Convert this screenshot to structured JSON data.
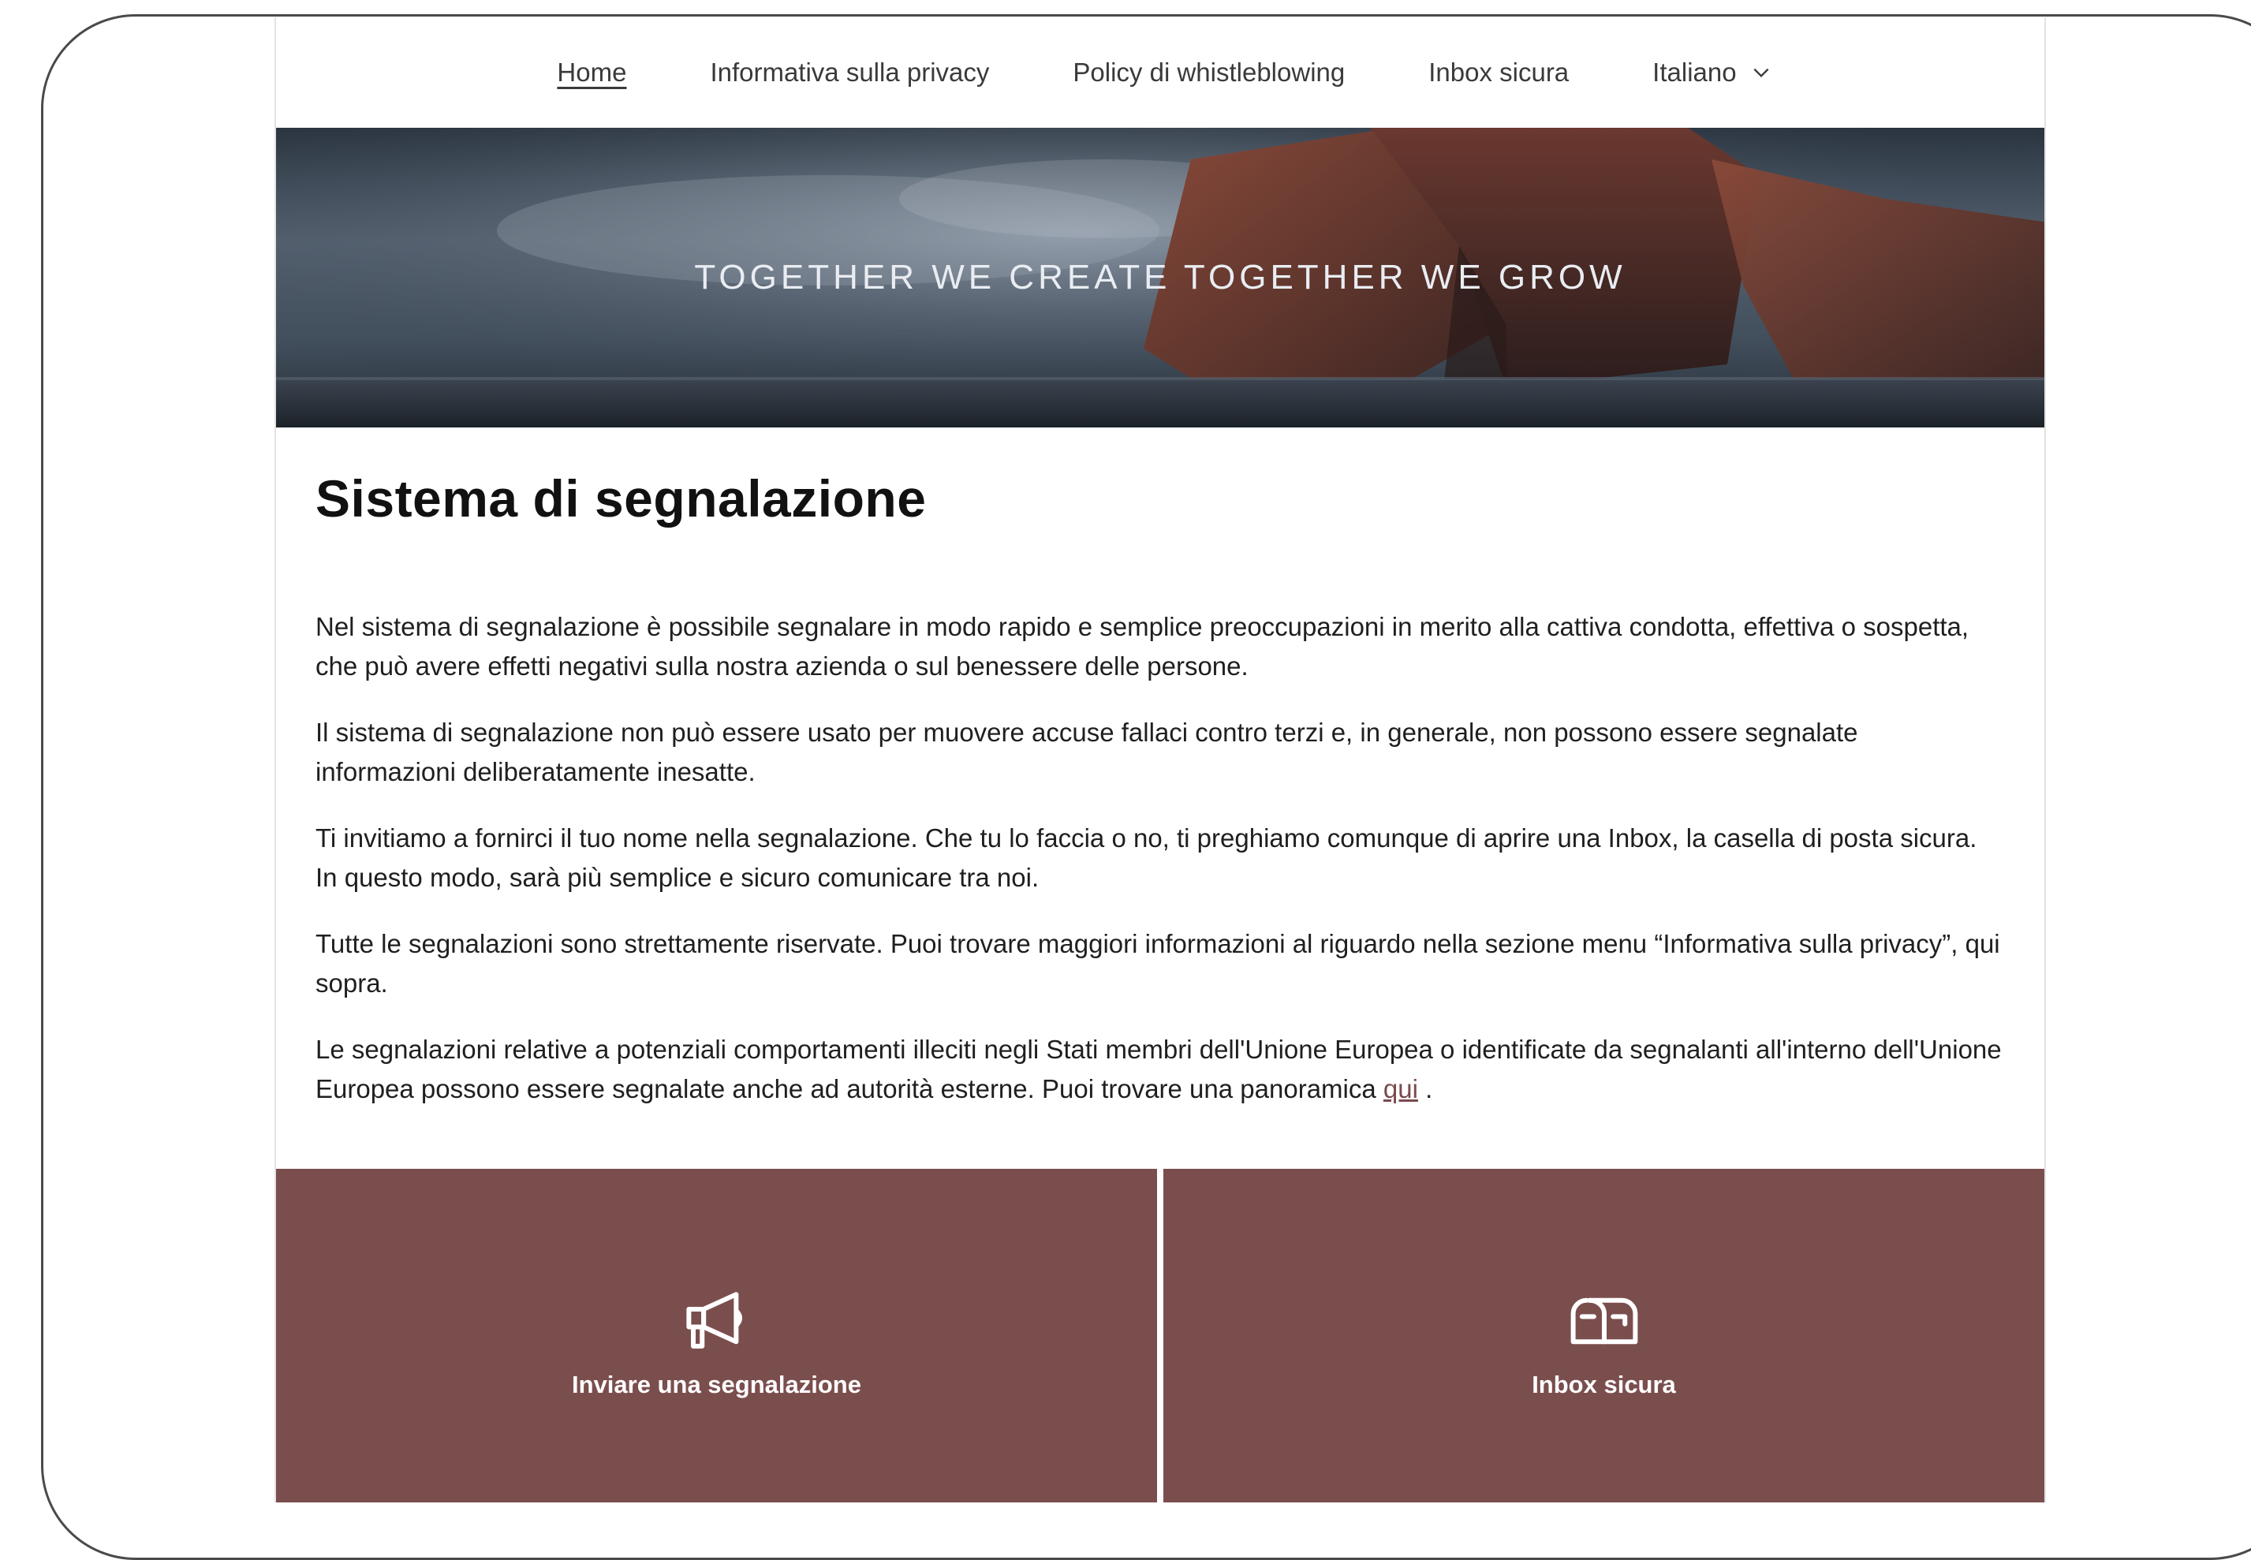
{
  "nav": {
    "items": [
      {
        "label": "Home",
        "active": true
      },
      {
        "label": "Informativa sulla privacy",
        "active": false
      },
      {
        "label": "Policy di whistleblowing",
        "active": false
      },
      {
        "label": "Inbox sicura",
        "active": false
      }
    ],
    "language": "Italiano",
    "language_icon": "chevron-down-icon"
  },
  "hero": {
    "tagline": "TOGETHER WE CREATE TOGETHER WE GROW"
  },
  "main": {
    "title": "Sistema di segnalazione",
    "paragraphs": [
      "Nel sistema di segnalazione è possibile segnalare in modo rapido e semplice preoccupazioni in merito alla cattiva condotta, effettiva o sospetta, che può avere effetti negativi sulla nostra azienda o sul benessere delle persone.",
      " Il sistema di segnalazione non può essere usato per muovere accuse fallaci contro terzi e, in generale, non possono essere segnalate informazioni deliberatamente inesatte.",
      "Ti invitiamo a fornirci il tuo nome nella segnalazione. Che tu lo faccia o no, ti preghiamo comunque di aprire una Inbox, la casella di posta sicura. In questo modo, sarà più semplice e sicuro comunicare tra noi.",
      "Tutte le segnalazioni sono strettamente riservate. Puoi trovare maggiori informazioni al riguardo nella sezione menu “Informativa sulla privacy”, qui sopra."
    ],
    "last_paragraph": {
      "text": "Le segnalazioni relative a potenziali comportamenti illeciti negli Stati membri dell'Unione Europea o identificate da segnalanti all'interno dell'Unione Europea possono essere segnalate anche ad autorità esterne. Puoi trovare una panoramica ",
      "link": "qui",
      "after": " ."
    }
  },
  "tiles": [
    {
      "label": "Inviare una segnalazione",
      "icon": "megaphone-icon"
    },
    {
      "label": "Inbox sicura",
      "icon": "mailbox-icon"
    }
  ],
  "colors": {
    "accent": "#7b4e4e",
    "link": "#7a4a4d"
  }
}
